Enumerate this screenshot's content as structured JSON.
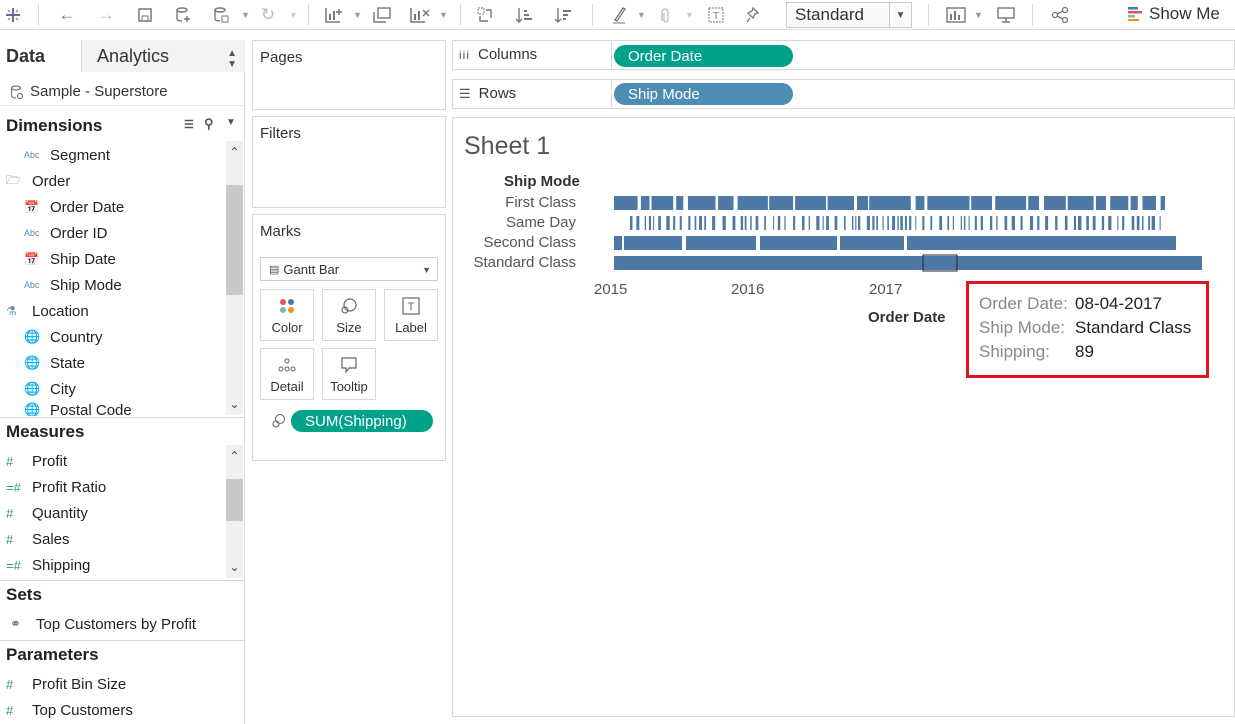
{
  "toolbar": {
    "mark_size_select": "Standard",
    "show_me_label": "Show Me"
  },
  "data_pane": {
    "tab_data": "Data",
    "tab_analytics": "Analytics",
    "datasource": "Sample - Superstore",
    "dimensions_header": "Dimensions",
    "dimensions": [
      {
        "label": "Segment",
        "type": "Abc"
      },
      {
        "label": "Order",
        "type": "folder"
      },
      {
        "label": "Order Date",
        "type": "date"
      },
      {
        "label": "Order ID",
        "type": "Abc"
      },
      {
        "label": "Ship Date",
        "type": "date"
      },
      {
        "label": "Ship Mode",
        "type": "Abc"
      },
      {
        "label": "Location",
        "type": "hierarchy"
      },
      {
        "label": "Country",
        "type": "geo"
      },
      {
        "label": "State",
        "type": "geo"
      },
      {
        "label": "City",
        "type": "geo"
      },
      {
        "label": "Postal Code",
        "type": "geo"
      }
    ],
    "measures_header": "Measures",
    "measures": [
      {
        "label": "Profit",
        "type": "#"
      },
      {
        "label": "Profit Ratio",
        "type": "=#"
      },
      {
        "label": "Quantity",
        "type": "#"
      },
      {
        "label": "Sales",
        "type": "#"
      },
      {
        "label": "Shipping",
        "type": "=#"
      }
    ],
    "sets_header": "Sets",
    "sets": [
      {
        "label": "Top Customers by Profit"
      }
    ],
    "parameters_header": "Parameters",
    "parameters": [
      {
        "label": "Profit Bin Size",
        "type": "#"
      },
      {
        "label": "Top Customers",
        "type": "#"
      }
    ]
  },
  "cards": {
    "pages_title": "Pages",
    "filters_title": "Filters",
    "marks_title": "Marks",
    "marks_type": "Gantt Bar",
    "mark_buttons": [
      "Color",
      "Size",
      "Label",
      "Detail",
      "Tooltip"
    ],
    "detail_pill": "SUM(Shipping)"
  },
  "shelves": {
    "columns_label": "Columns",
    "columns_pill": "Order Date",
    "rows_label": "Rows",
    "rows_pill": "Ship Mode"
  },
  "colors": {
    "mark": "#4e79a7",
    "green_pill": "#00a38a",
    "blue_pill": "#4e8db3",
    "highlight": "#e0141e"
  },
  "viz": {
    "sheet_title": "Sheet 1",
    "row_header_title": "Ship Mode",
    "x_axis_title": "Order Date",
    "x_ticks": [
      "2015",
      "2016",
      "2017"
    ]
  },
  "chart_data": {
    "type": "bar",
    "subtype": "gantt",
    "title": "Sheet 1",
    "xlabel": "Order Date",
    "ylabel": "Ship Mode",
    "x_ticks": [
      "2015",
      "2016",
      "2017"
    ],
    "xlim": [
      "2015-01-01",
      "2018-12-31"
    ],
    "categories": [
      "First Class",
      "Same Day",
      "Second Class",
      "Standard Class"
    ],
    "series": [
      {
        "name": "First Class",
        "coverage": "dense marks with small gaps across 2015–2018"
      },
      {
        "name": "Same Day",
        "coverage": "sparse thin marks across 2015–2018"
      },
      {
        "name": "Second Class",
        "coverage": "near-continuous marks 2015–2018"
      },
      {
        "name": "Standard Class",
        "coverage": "continuous marks 2015–2018"
      }
    ],
    "highlighted_mark": {
      "Order Date": "08-04-2017",
      "Ship Mode": "Standard Class",
      "Shipping": 89
    }
  },
  "tooltip": {
    "rows": [
      {
        "key": "Order Date:",
        "value": "08-04-2017"
      },
      {
        "key": "Ship Mode:",
        "value": "Standard Class"
      },
      {
        "key": "Shipping:",
        "value": "89"
      }
    ]
  }
}
